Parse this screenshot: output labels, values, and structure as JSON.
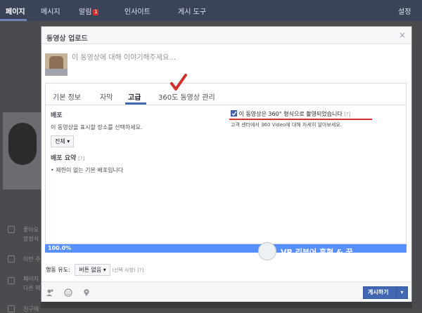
{
  "colors": {
    "accent": "#4267b2",
    "progress": "#5890ff",
    "annotation": "#d0312d"
  },
  "nav": {
    "items": [
      "페이지",
      "메시지",
      "알림",
      "인사이트",
      "게시 도구"
    ],
    "notification_count": "1",
    "settings": "설정"
  },
  "sidebar": {
    "items": [
      "좋아요",
      "장정석",
      "이번 주",
      "페이지",
      "다른 페",
      "친구에"
    ]
  },
  "dialog": {
    "title": "동영상 업로드",
    "close_icon": "close-icon",
    "compose_placeholder": "이 동영상에 대해 이야기해주세요...",
    "tabs": [
      "기본 정보",
      "자막",
      "고급",
      "360도 동영상 관리"
    ],
    "active_tab": "고급",
    "distribution": {
      "label": "배포",
      "desc": "이 동영상을 표시할 장소를 선택하세요.",
      "selected": "전체"
    },
    "summary": {
      "label": "배포 요약",
      "help": "[?]",
      "bullet": "제한이 없는 기본 배포입니다"
    },
    "checkbox_360": {
      "checked": true,
      "label": "이 동영상은 360° 형식으로 촬영되었습니다",
      "help": "[?]",
      "note": "고객 센터에서 360 Video에 대해 자세히 알아보세요."
    },
    "progress": {
      "percent": 100,
      "label": "100.0%"
    },
    "watermark": "VR 리뷰어 흑형 & 꿈",
    "cta": {
      "label": "행동 유도:",
      "selected": "버튼 없음",
      "optional": "(선택 사항)",
      "help": "[?]"
    },
    "publish_label": "게시하기"
  }
}
